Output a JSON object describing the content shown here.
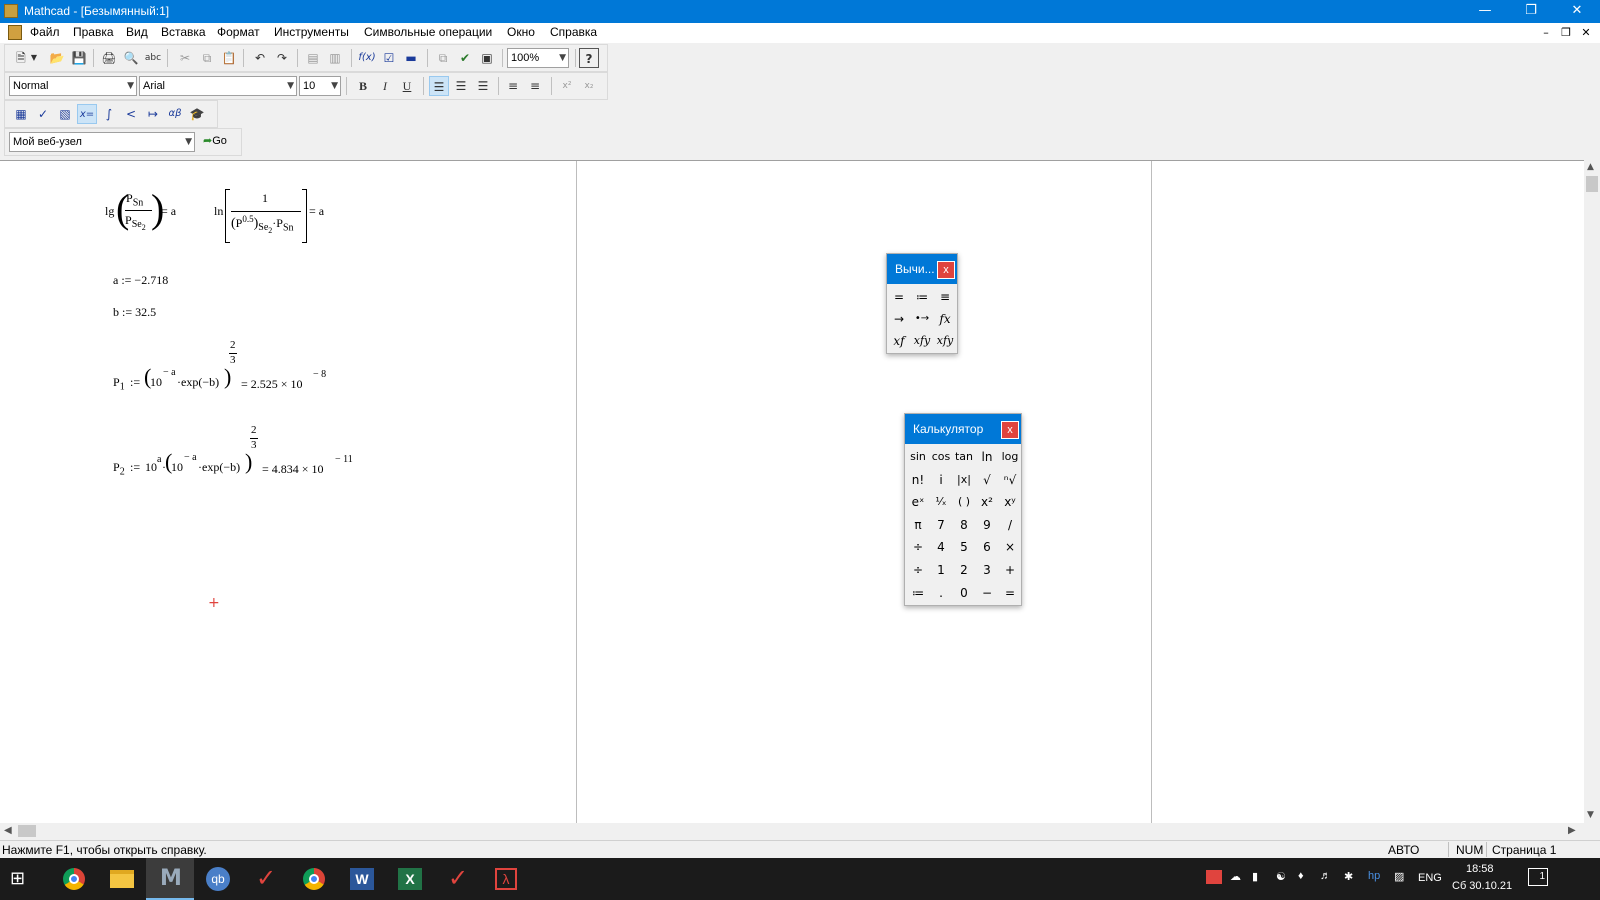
{
  "window": {
    "title": "Mathcad - [Безымянный:1]"
  },
  "menu": [
    "Файл",
    "Правка",
    "Вид",
    "Вставка",
    "Формат",
    "Инструменты",
    "Символьные операции",
    "Окно",
    "Справка"
  ],
  "formatting": {
    "style": "Normal",
    "font": "Arial",
    "size": "10"
  },
  "zoom": "100%",
  "web": {
    "address": "Мой веб-узел",
    "go_label": "Go"
  },
  "worksheet": {
    "eq1": {
      "lg": "lg",
      "num": "P",
      "num_sub": "Sn",
      "den": "P",
      "den_sub": "Se",
      "den_sub2": "2",
      "rhs": "= a"
    },
    "eq2": {
      "ln": "ln",
      "num": "1",
      "den_p": "P",
      "den_pow": "0.5",
      "den_sub": "Se",
      "den_sub2": "2",
      "dot": "·",
      "p2": "P",
      "p2_sub": "Sn",
      "rhs": "= a"
    },
    "a_def": "a := −2.718",
    "b_def": "b := 32.5",
    "p1": {
      "lhs": "P",
      "sub": "1",
      "assign": ":=",
      "base": "10",
      "exp": "− a",
      "tail": "·exp(−b)",
      "frac_num": "2",
      "frac_den": "3",
      "result": "= 2.525 × 10",
      "result_exp": "− 8"
    },
    "p2": {
      "lhs": "P",
      "sub": "2",
      "assign": ":=",
      "pre": "10",
      "pre_exp": "a",
      "dot": "·",
      "base": "10",
      "exp": "− a",
      "tail": "·exp(−b)",
      "frac_num": "2",
      "frac_den": "3",
      "result": "= 4.834 × 10",
      "result_exp": "− 11"
    },
    "cursor": "+"
  },
  "evaluation_palette": {
    "title": "Вычи...",
    "close": "x",
    "buttons": [
      "=",
      "≔",
      "≡",
      "→",
      "•→",
      "fx",
      "xf",
      "xfy",
      "xfy"
    ]
  },
  "calculator_palette": {
    "title": "Калькулятор",
    "close": "x",
    "buttons": [
      "sin",
      "cos",
      "tan",
      "ln",
      "log",
      "n!",
      "i",
      "|x|",
      "√",
      "ⁿ√",
      "eˣ",
      "¹⁄ₓ",
      "( )",
      "x²",
      "xʸ",
      "π",
      "7",
      "8",
      "9",
      "/",
      "÷",
      "4",
      "5",
      "6",
      "×",
      "÷",
      "1",
      "2",
      "3",
      "+",
      "≔",
      ".",
      "0",
      "−",
      "="
    ]
  },
  "status": {
    "help": "Нажмите F1, чтобы открыть справку.",
    "auto": "АВТО",
    "num": "NUM",
    "page": "Страница 1"
  },
  "taskbar": {
    "lang": "ENG",
    "time": "18:58",
    "date": "Сб 30.10.21",
    "notif": "1"
  },
  "colors": {
    "titlebar": "#0078d7",
    "accent_red": "#e0443e",
    "taskbar": "#1b1b1b"
  }
}
